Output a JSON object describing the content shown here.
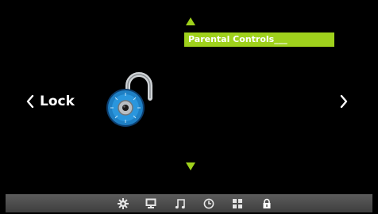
{
  "page": {
    "left_label": "Lock"
  },
  "menu": {
    "selected_item": "Parental Controls___"
  },
  "bottom_bar": {
    "icons": [
      "gear-icon",
      "monitor-icon",
      "music-note-icon",
      "clock-icon",
      "grid-icon",
      "lock-icon"
    ],
    "active": "lock-icon"
  },
  "colors": {
    "accent": "#9fd11c",
    "background": "#000000",
    "bar": "#4a4a4a",
    "lock_blue": "#1e7fc4"
  }
}
